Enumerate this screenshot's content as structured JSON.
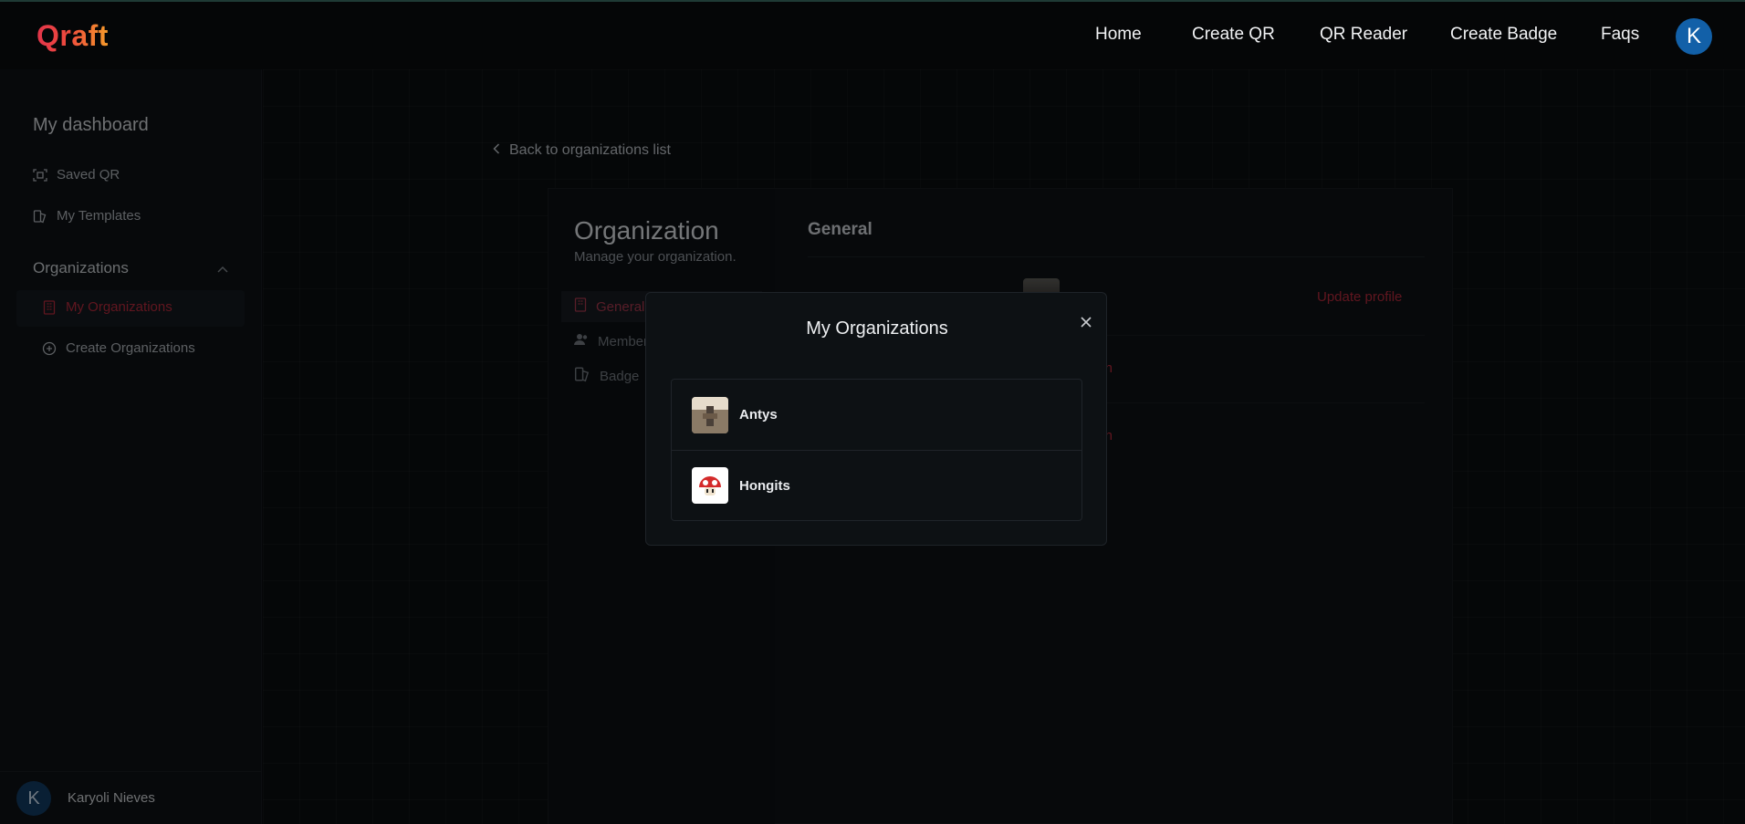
{
  "header": {
    "logo": "Qraft",
    "nav": [
      {
        "label": "Home"
      },
      {
        "label": "Create QR"
      },
      {
        "label": "QR Reader"
      },
      {
        "label": "Create Badge"
      },
      {
        "label": "Faqs"
      }
    ],
    "avatar_initial": "K"
  },
  "sidebar": {
    "title": "My dashboard",
    "items": [
      {
        "label": "Saved QR",
        "icon": "scan-icon"
      },
      {
        "label": "My Templates",
        "icon": "templates-icon"
      }
    ],
    "section": {
      "label": "Organizations",
      "icon": "chevron-up-icon"
    },
    "section_items": [
      {
        "label": "My Organizations",
        "icon": "building-icon",
        "active": true
      },
      {
        "label": "Create Organizations",
        "icon": "plus-circle-icon",
        "active": false
      }
    ],
    "user": {
      "initial": "K",
      "name": "Karyoli Nieves"
    }
  },
  "main": {
    "back_link": "Back to organizations list",
    "organization": {
      "title": "Organization",
      "subtitle": "Manage your organization.",
      "tabs": [
        {
          "label": "General",
          "icon": "building-icon",
          "active": true
        },
        {
          "label": "Members",
          "icon": "users-icon",
          "active": false
        },
        {
          "label": "Badge",
          "icon": "badge-icon",
          "active": false
        }
      ]
    },
    "general": {
      "title": "General",
      "update_profile": "Update profile",
      "link_1": "zation",
      "link_2": "zation"
    }
  },
  "modal": {
    "title": "My Organizations",
    "organizations": [
      {
        "name": "Antys"
      },
      {
        "name": "Hongits"
      }
    ]
  },
  "colors": {
    "accent_red": "#b0283a",
    "avatar_blue": "#1260a8"
  }
}
